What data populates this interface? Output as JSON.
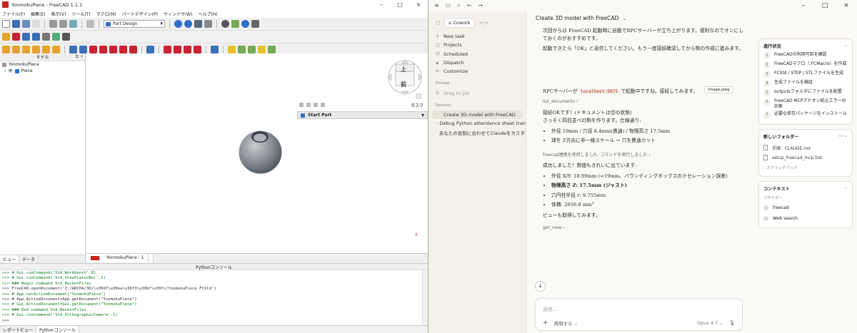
{
  "freecad": {
    "title": "YonmokuPiece - FreeCAD 1.1.1",
    "menu": [
      "ファイル(F)",
      "編集(E)",
      "表示(V)",
      "ツール(T)",
      "マクロ(M)",
      "パートデザイン(P)",
      "ウィンドウ(W)",
      "ヘルプ(H)"
    ],
    "workbench": "Part Design",
    "model_panel_title": "モデル",
    "tree": [
      {
        "label": "YonmokuPiece"
      },
      {
        "label": "Piece"
      }
    ],
    "model_tabs": [
      "ビュー",
      "データ"
    ],
    "navcube_top": "上",
    "navcube_front": "前",
    "task_label": "タスク",
    "start_part": "Start Part",
    "doc_tab": "YonmokuPiece : 1",
    "console_title": "Pythonコンソール",
    "console_lines": [
      ">>> # Gui.runCommand('Std_Workbench',8)",
      ">>> # Gui.runCommand('Std_ViewStatusBar',1)",
      ">>> ### Begin command Std_RecentFiles",
      ">>> FreeCAD.openDocument('Z:/ARCHA/3D/\\u30d7\\u30ea\\u30f3\\u30bf\\u30fc/YonmokuPiece.FCStd')",
      ">>> # App.setActiveDocument(\"YonmokuPiece\")",
      ">>> # App.ActiveDocument=App.getDocument(\"YonmokuPiece\")",
      ">>> # Gui.ActiveDocument=Gui.getDocument(\"YonmokuPiece\")",
      ">>> ### End command Std_RecentFiles",
      ">>> # Gui.runCommand('Std_OrthographicCamera',1)",
      ">>>"
    ],
    "bottom_tabs": [
      "レポートビュー",
      "Pythonコンソール"
    ],
    "colors": {
      "brand": "#c4261d",
      "model_blue": "#2f6fc9",
      "sphere": "#8a8f95"
    }
  },
  "claude": {
    "sidebar": {
      "mode": "Cowork",
      "items": [
        {
          "icon": "+",
          "label": "New task"
        },
        {
          "icon": "▢",
          "label": "Projects"
        },
        {
          "icon": "◷",
          "label": "Scheduled"
        },
        {
          "icon": "◈",
          "label": "Dispatch"
        },
        {
          "icon": "✎",
          "label": "Customize"
        }
      ],
      "pinned_title": "Pinned",
      "pinned_hint": "Drag to pin",
      "recents_title": "Recents",
      "recents": [
        "Create 3D model with FreeCAD",
        "Debug Python attendance sheet tran",
        "あなたの役割に合わせてClaudeをカスタマイ"
      ]
    },
    "chat_title": "Create 3D model with FreeCAD",
    "messages": {
      "p1": "次回からは FreeCAD 起動時に自動でRPCサーバーが立ち上がります。便利なのでオンにしておくのがおすすめです。",
      "p2": "起動できたら「OK」と返信してください。もう一度接続確認してから駒の作成に進みます。",
      "image_chip": "image.jpeg",
      "p3_pre": "RPCサーバーが",
      "p3_code": "localhost:9875",
      "p3_post": "で起動中ですね。接続してみます。",
      "tool1": "list_documents ›",
      "p4": "接続OKです！(ドキュメントは空の状態)",
      "p5": "さっそく四目並べの駒を作ります。仕様通り:",
      "spec": [
        "外径 19mm / 穴径 8.4mm(貫通) / 物理高さ 17.5mm",
        "球を Z方向に非一様スケール → 穴を貫通カット"
      ],
      "tool2": "freecad連携を使用しました, コマンドを実行しました ›",
      "p6": "成功しました！数値もきれいに出ています:",
      "results": [
        "外径 X/Y: 18.99mm (≈19mm、バウンディングボックスのテセレーション誤差)",
        "物理高さ Z: 17.5mm (ジャスト)",
        "穴円柱半径 r: 9.755mm",
        "体積: 2656.8 mm³"
      ],
      "p7": "ビューも取得してみます。",
      "tool3": "get_view ›"
    },
    "composer": {
      "placeholder": "返信...",
      "attach": "+",
      "mode": "質問する ⌄",
      "model": "Opus 4.7 ⌄",
      "mic": "🎙"
    },
    "progress": {
      "title": "進行状況",
      "items": [
        "FreeCADの利用可否を確認",
        "FreeCADマクロ（.FCMacro）を作成",
        "FCStd / STEP / STLファイルを生成",
        "生成ファイルを検証",
        "outputsフォルダにファイルを配置",
        "FreeCAD MCPアドオン統込エラーの診断",
        "必要な依存パッケージをインストール"
      ]
    },
    "folder": {
      "title": "新しいフォルダー",
      "files": [
        "手順 · CLAUDE.md",
        "setup_freecad_mcp.bat"
      ],
      "scratch": "› スクラッチパッド"
    },
    "context": {
      "title": "コンテキスト",
      "sub": "コネクター",
      "items": [
        "freecad",
        "Web search"
      ]
    }
  }
}
